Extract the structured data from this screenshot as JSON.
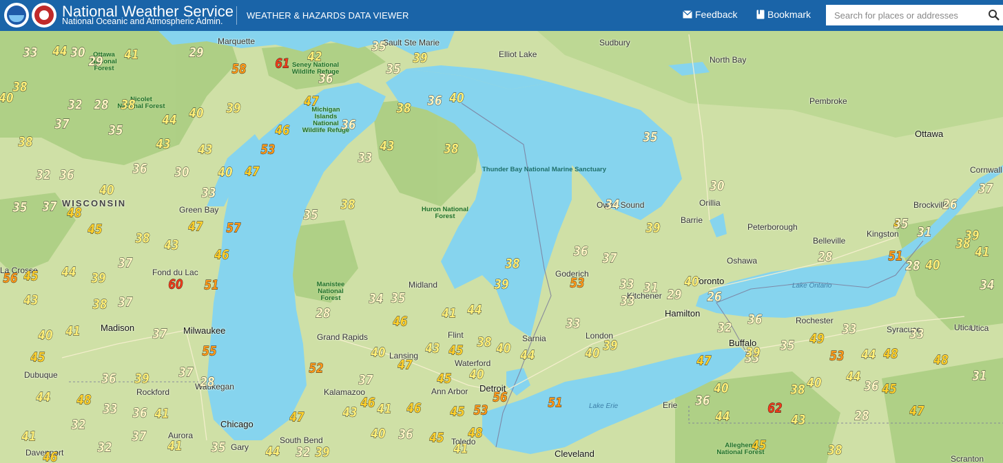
{
  "header": {
    "agency_title": "National Weather Service",
    "agency_subtitle": "National Oceanic and Atmospheric Admin.",
    "app_title": "WEATHER & HAZARDS DATA VIEWER",
    "feedback_label": "Feedback",
    "bookmark_label": "Bookmark",
    "search_placeholder": "Search for places or addresses"
  },
  "colors": {
    "header_bg": "#1a64a8",
    "water": "#86d4ee",
    "land": "#cfe0a6",
    "forest": "#9fc77a"
  },
  "map": {
    "cities": [
      "Marquette",
      "Sault Ste Marie",
      "Elliot Lake",
      "Sudbury",
      "North Bay",
      "Pembroke",
      "Ottawa",
      "Cornwall",
      "Brockville",
      "Kingston",
      "Belleville",
      "Peterborough",
      "Barrie",
      "Orillia",
      "Owen Sound",
      "Oshawa",
      "Toronto",
      "Hamilton",
      "Kitchener",
      "Goderich",
      "London",
      "Sarnia",
      "Rochester",
      "Syracuse",
      "Utica",
      "Buffalo",
      "Erie",
      "Scranton",
      "Cleveland",
      "Toledo",
      "Detroit",
      "Ann Arbor",
      "Waterford",
      "Flint",
      "Lansing",
      "Midland",
      "Grand Rapids",
      "Kalamazoo",
      "South Bend",
      "Gary",
      "Chicago",
      "Aurora",
      "Rockford",
      "Davenport",
      "Dubuque",
      "Madison",
      "Milwaukee",
      "Waukegan",
      "Fond du Lac",
      "Green Bay",
      "La Crosse",
      "Utica"
    ],
    "region_labels": [
      "WISCONSIN"
    ],
    "park_labels": [
      "Ottawa National Forest",
      "Seney National Wildlife Refuge",
      "Nicolet National Forest",
      "Michigan Islands National Wildlife Refuge",
      "Huron National Forest",
      "Manistee National Forest",
      "Allegheny National Forest",
      "Thunder Bay National Marine Sanctuary"
    ],
    "lake_labels": [
      "Lake Ontario",
      "Lake Erie"
    ],
    "temperatures": [
      33,
      44,
      30,
      41,
      29,
      29,
      58,
      61,
      42,
      36,
      35,
      39,
      35,
      38,
      32,
      28,
      38,
      40,
      37,
      35,
      44,
      39,
      47,
      36,
      46,
      53,
      40,
      47,
      38,
      43,
      43,
      36,
      30,
      43,
      33,
      38,
      38,
      36,
      40,
      32,
      36,
      40,
      48,
      47,
      57,
      46,
      33,
      35,
      38,
      43,
      45,
      38,
      37,
      60,
      51,
      44,
      39,
      45,
      43,
      35,
      37,
      38,
      37,
      40,
      41,
      37,
      55,
      28,
      37,
      39,
      36,
      44,
      48,
      33,
      36,
      41,
      32,
      41,
      37,
      41,
      32,
      35,
      37,
      47,
      43,
      46,
      41,
      46,
      45,
      53,
      40,
      36,
      48,
      45,
      41,
      44,
      32,
      39,
      38,
      46,
      52,
      37,
      40,
      47,
      43,
      45,
      38,
      40,
      40,
      28,
      34,
      35,
      44,
      46,
      39,
      38,
      41,
      44,
      51,
      56,
      45,
      40,
      39,
      37,
      33,
      31,
      33,
      29,
      40,
      30,
      26,
      35,
      34,
      39,
      53,
      36,
      33,
      32,
      36,
      33,
      47,
      39,
      35,
      49,
      53,
      44,
      48,
      48,
      33,
      44,
      36,
      45,
      38,
      40,
      44,
      36,
      40,
      62,
      43,
      28,
      47,
      38,
      41,
      34,
      26,
      37,
      31,
      39,
      28,
      33,
      40,
      45,
      51,
      28,
      35,
      31,
      45,
      38,
      32,
      30,
      44,
      35,
      56,
      45,
      40,
      31
    ]
  }
}
